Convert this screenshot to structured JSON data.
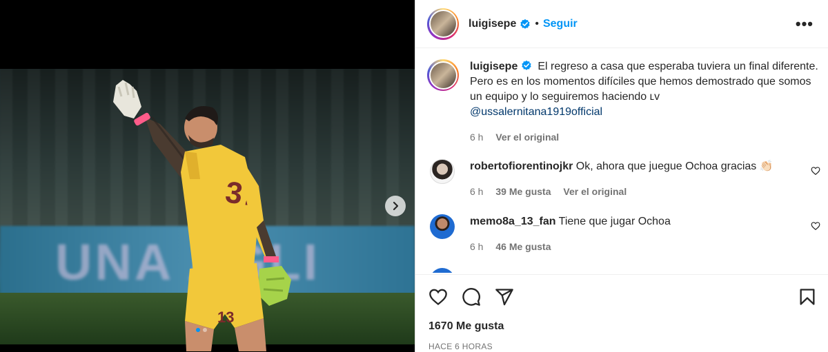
{
  "post": {
    "username": "luigisepe",
    "follow_label": "Seguir",
    "separator": "•",
    "caption": "El regreso a casa que esperaba tuviera un final diferente. Pero es en los momentos difíciles que hemos demostrado que somos un equipo y lo seguiremos haciendo ʟᴠ",
    "mention": "@ussalernitana1919official",
    "caption_time": "6 h",
    "see_original": "Ver el original",
    "likes": "1670 Me gusta",
    "posted": "HACE 6 HORAS"
  },
  "media": {
    "banner_text": "UNA  AGLI",
    "jersey_number": "13",
    "carousel_count": 2,
    "carousel_active": 1
  },
  "comments": [
    {
      "username": "robertofiorentinojkr",
      "text": "Ok, ahora que juegue Ochoa gracias 👏🏻",
      "time": "6 h",
      "likes": "39 Me gusta",
      "see_original": "Ver el original"
    },
    {
      "username": "memo8a_13_fan",
      "text": "Tiene que jugar Ochoa",
      "time": "6 h",
      "likes": "46 Me gusta"
    }
  ],
  "colors": {
    "accent": "#0095f6",
    "mention": "#00376b",
    "muted": "#737373",
    "jersey": "#f2c83a"
  },
  "icons": [
    "verified-icon",
    "more-icon",
    "heart-icon",
    "comment-icon",
    "share-icon",
    "bookmark-icon",
    "chevron-right-icon"
  ]
}
